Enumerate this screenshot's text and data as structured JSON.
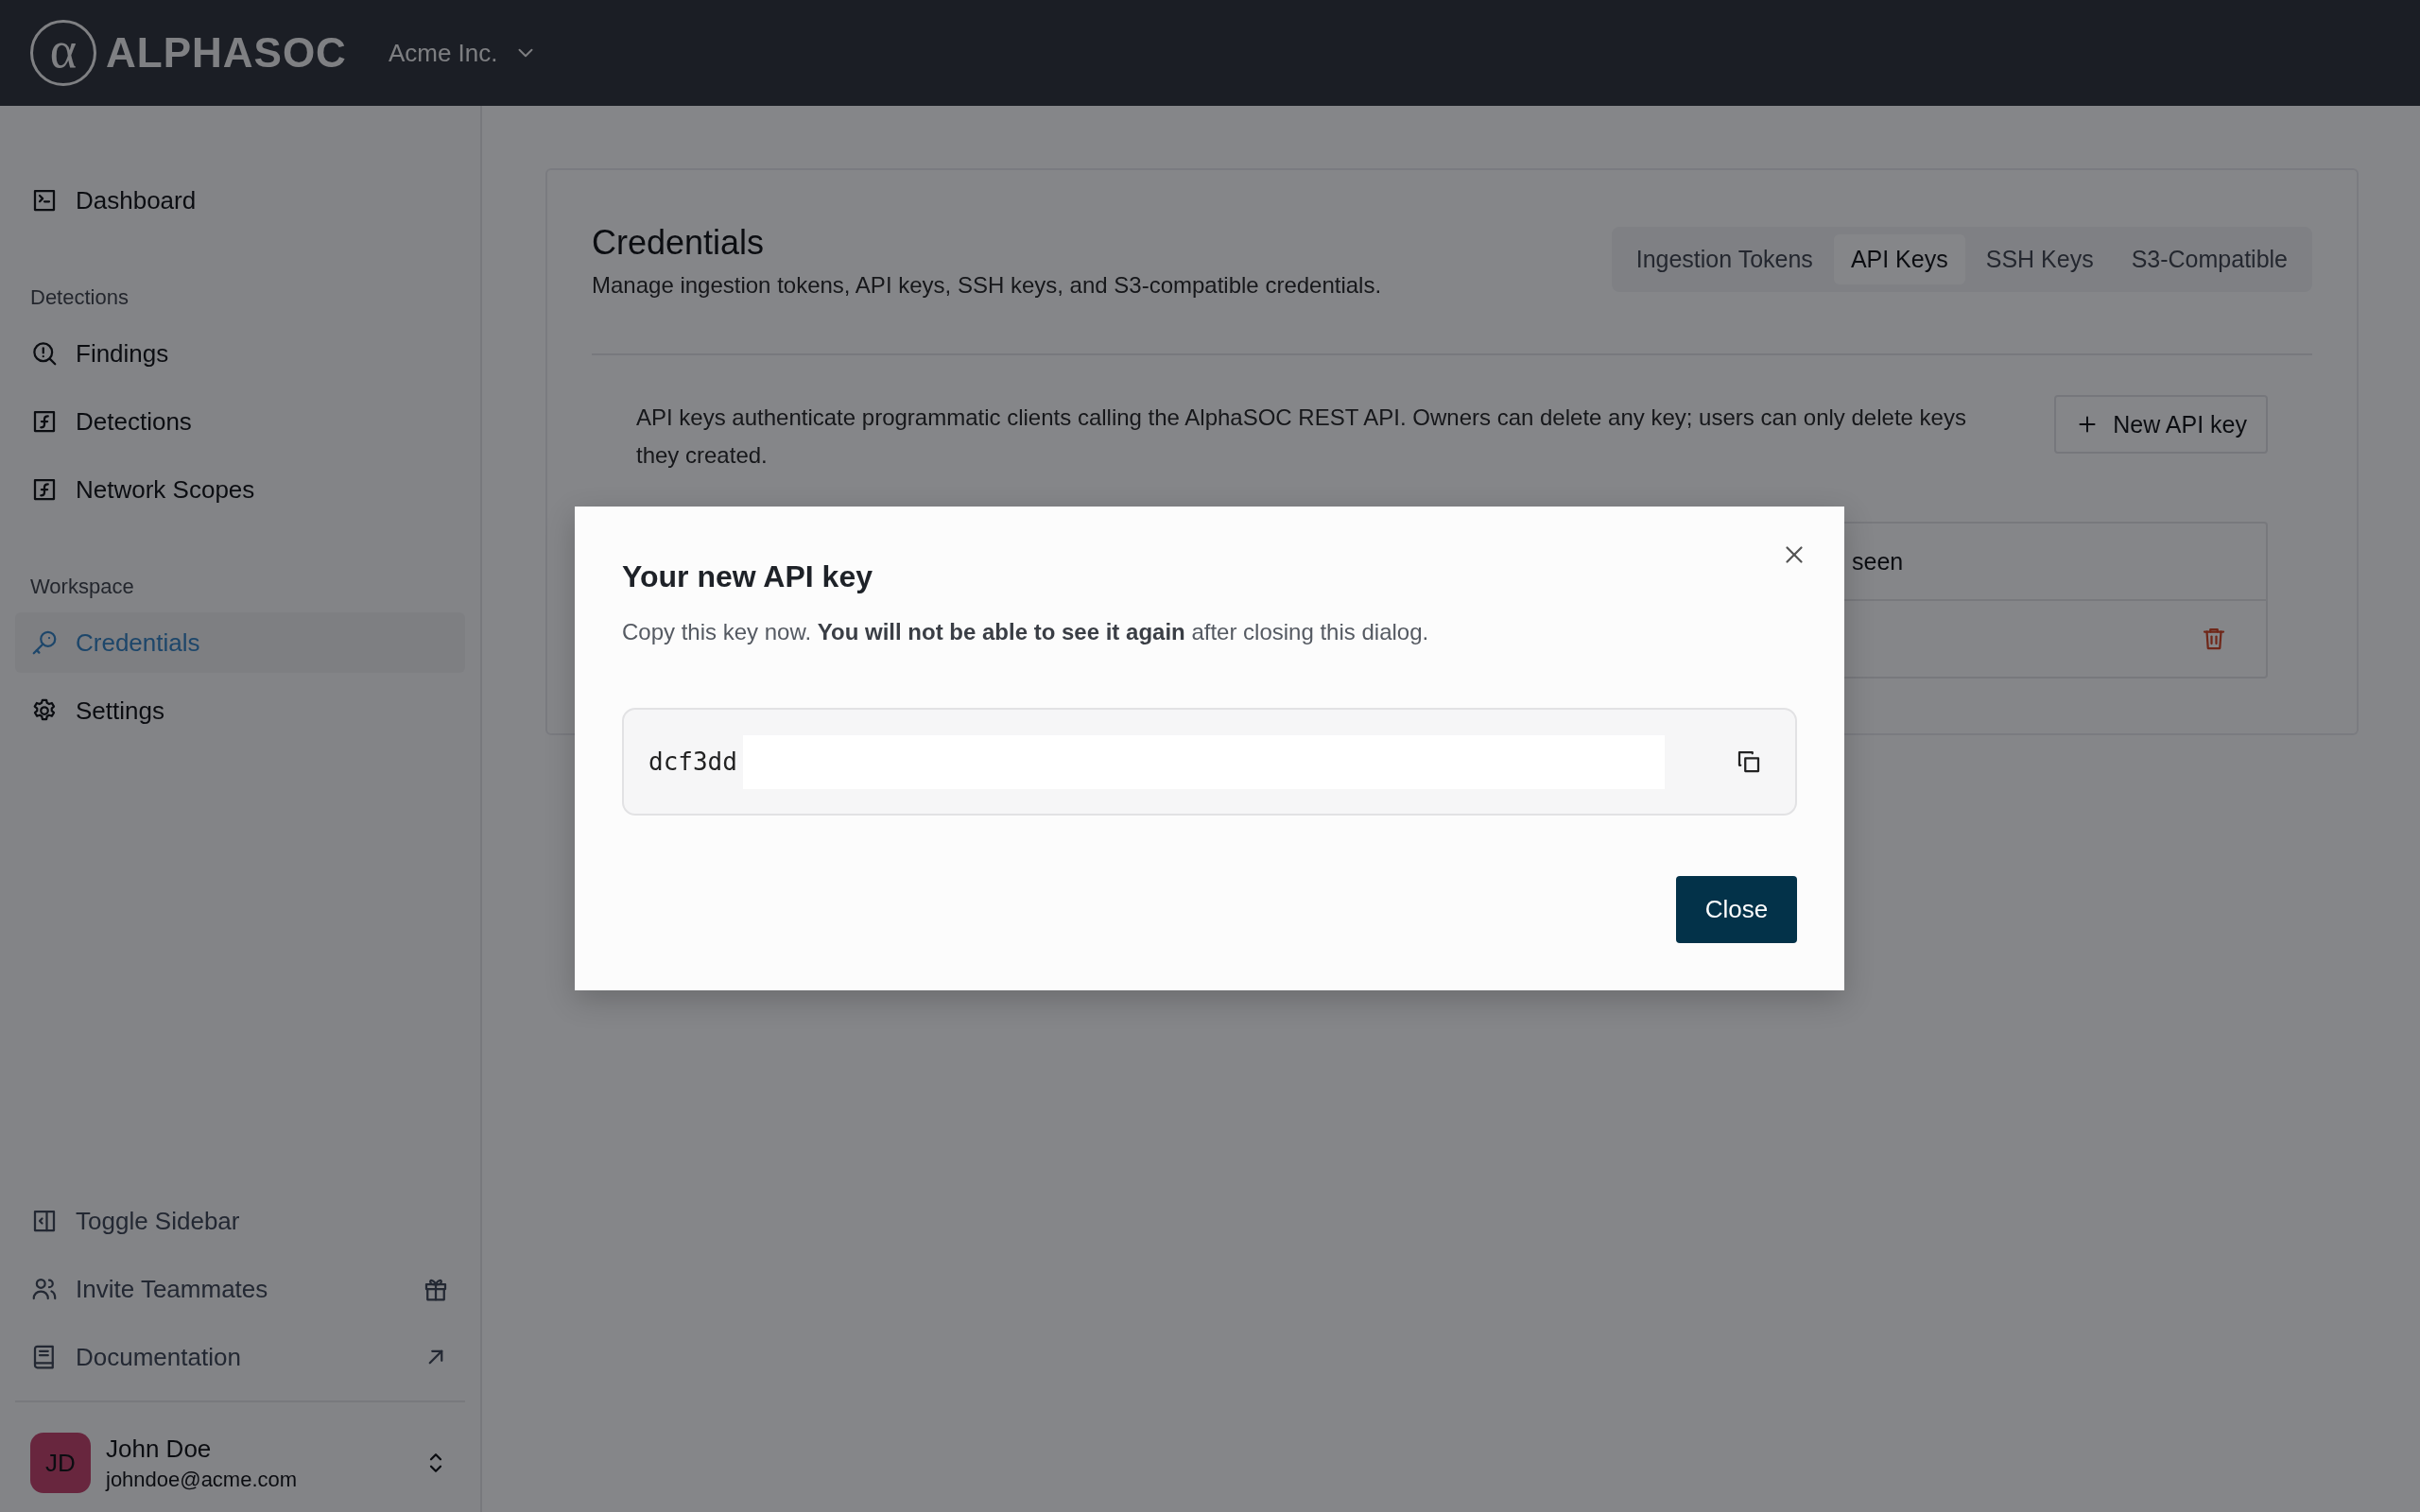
{
  "header": {
    "logo_mark": "α",
    "logo_text": "ALPHASOC",
    "org": "Acme Inc."
  },
  "sidebar": {
    "groups": [
      {
        "items": [
          {
            "label": "Dashboard",
            "selected": false
          }
        ]
      },
      {
        "heading": "Detections",
        "items": [
          {
            "label": "Findings",
            "selected": false
          },
          {
            "label": "Detections",
            "selected": false
          },
          {
            "label": "Network Scopes",
            "selected": false
          }
        ]
      },
      {
        "heading": "Workspace",
        "items": [
          {
            "label": "Credentials",
            "selected": true
          },
          {
            "label": "Settings",
            "selected": false
          }
        ]
      }
    ],
    "footer_items": [
      {
        "label": "Toggle Sidebar"
      },
      {
        "label": "Invite Teammates"
      },
      {
        "label": "Documentation"
      }
    ],
    "user": {
      "initials": "JD",
      "name": "John Doe",
      "email": "johndoe@acme.com"
    }
  },
  "page": {
    "title": "Credentials",
    "subtitle": "Manage ingestion tokens, API keys, SSH keys, and S3-compatible credentials.",
    "tabs": [
      {
        "label": "Ingestion Tokens",
        "selected": false
      },
      {
        "label": "API Keys",
        "selected": true
      },
      {
        "label": "SSH Keys",
        "selected": false
      },
      {
        "label": "S3-Compatible",
        "selected": false
      }
    ],
    "description": "API keys authenticate programmatic clients calling the AlphaSOC REST API. Owners can delete any key; users can only delete keys they created.",
    "new_button": "New API key",
    "table": {
      "visible_header": "seen"
    }
  },
  "dialog": {
    "title": "Your new API key",
    "text": "Copy this key now. **You will not be able to see it again** after closing this dialog.",
    "key": "dcf3dd",
    "close_button": "Close"
  }
}
